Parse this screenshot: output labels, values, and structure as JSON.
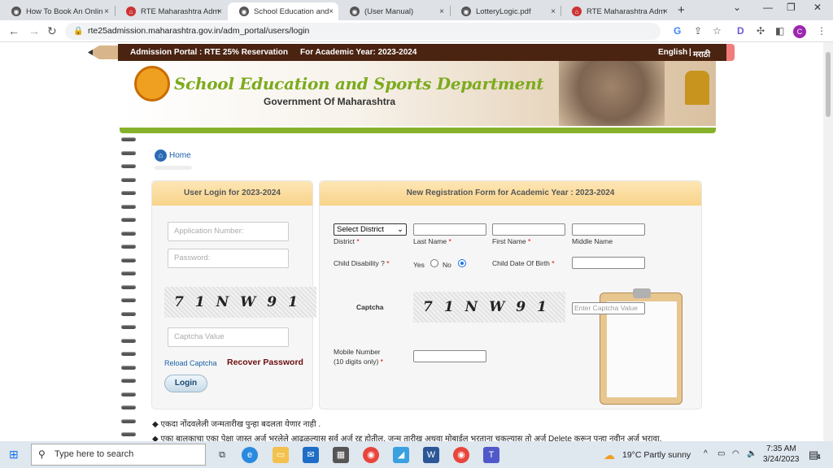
{
  "browser": {
    "tabs": [
      {
        "label": "How To Book An Onlin",
        "favicon": "globe-icon",
        "active": false
      },
      {
        "label": "RTE Maharashtra Adm",
        "favicon": "school-icon",
        "active": false
      },
      {
        "label": "School Education and",
        "favicon": "globe-icon",
        "active": true
      },
      {
        "label": "(User Manual)",
        "favicon": "globe-icon",
        "active": false
      },
      {
        "label": "LotteryLogic.pdf",
        "favicon": "globe-icon",
        "active": false
      },
      {
        "label": "RTE Maharashtra Adm",
        "favicon": "school-icon",
        "active": false
      }
    ],
    "close_glyph": "×",
    "new_tab_glyph": "+",
    "url": "rte25admission.maharashtra.gov.in/adm_portal/users/login",
    "profile_initial": "C"
  },
  "header": {
    "portal_label": "Admission Portal : RTE 25% Reservation",
    "year_label": "For Academic Year: 2023-2024",
    "lang_english": "English",
    "lang_separator": "|",
    "lang_marathi": "मराठी",
    "title": "School Education and Sports Department",
    "subtitle": "Government Of Maharashtra"
  },
  "breadcrumb": {
    "home": "Home"
  },
  "login": {
    "heading": "User Login for 2023-2024",
    "application_placeholder": "Application Number:",
    "password_placeholder": "Password:",
    "captcha_text": "71NW91",
    "captcha_placeholder": "Captcha Value",
    "reload_captcha": "Reload Captcha",
    "recover_password": "Recover Password",
    "login_button": "Login"
  },
  "registration": {
    "heading": "New Registration Form for Academic Year : 2023-2024",
    "district_selected": "Select District",
    "district_label": "District",
    "last_name_label": "Last Name",
    "first_name_label": "First Name",
    "middle_name_label": "Middle Name",
    "disability_label": "Child Disability ?",
    "yes_label": "Yes",
    "no_label": "No",
    "disability_value": "No",
    "dob_label": "Child Date Of Birth",
    "captcha_label": "Captcha",
    "captcha_text": "71NW91",
    "captcha_placeholder": "Enter Captcha Value",
    "mobile_label_line1": "Mobile Number",
    "mobile_label_line2": "(10 digits only)",
    "required_mark": "*"
  },
  "notes": [
    "एकदा नोंदवलेली जन्मतारीख पुन्हा बदलता येणार नाही .",
    "एका बालकाचा एका पेक्षा जास्त अर्ज भरलेले आढळल्यास सर्व अर्ज रद्द होतील. जन्म तारीख अथवा मोबाईल भरताना चुकल्यास तो अर्ज Delete करून पुन्हा नवीन अर्ज भरावा."
  ],
  "taskbar": {
    "search_placeholder": "Type here to search",
    "weather": "19°C  Partly sunny",
    "time": "7:35 AM",
    "date": "3/24/2023",
    "notification_count": "4"
  }
}
